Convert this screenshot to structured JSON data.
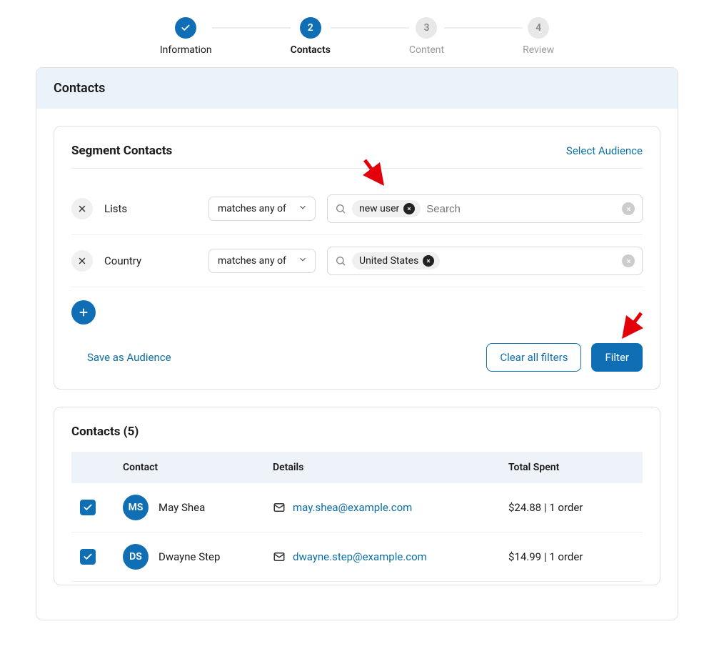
{
  "stepper": {
    "steps": [
      {
        "label": "Information",
        "status": "done"
      },
      {
        "label": "Contacts",
        "status": "active",
        "num": "2"
      },
      {
        "label": "Content",
        "status": "pending",
        "num": "3"
      },
      {
        "label": "Review",
        "status": "pending",
        "num": "4"
      }
    ]
  },
  "panel": {
    "header": "Contacts"
  },
  "segment": {
    "title": "Segment Contacts",
    "select_audience": "Select Audience",
    "filters": [
      {
        "field": "Lists",
        "operator": "matches any of",
        "tags": [
          "new user"
        ],
        "placeholder": "Search"
      },
      {
        "field": "Country",
        "operator": "matches any of",
        "tags": [
          "United States"
        ],
        "placeholder": ""
      }
    ],
    "save_audience": "Save as Audience",
    "clear_filters": "Clear all filters",
    "filter_btn": "Filter"
  },
  "contacts": {
    "title": "Contacts (5)",
    "columns": {
      "c1": "Contact",
      "c2": "Details",
      "c3": "Total Spent"
    },
    "rows": [
      {
        "initials": "MS",
        "name": "May Shea",
        "email": "may.shea@example.com",
        "spent": "$24.88 | 1 order"
      },
      {
        "initials": "DS",
        "name": "Dwayne Step",
        "email": "dwayne.step@example.com",
        "spent": "$14.99 | 1 order"
      }
    ]
  }
}
